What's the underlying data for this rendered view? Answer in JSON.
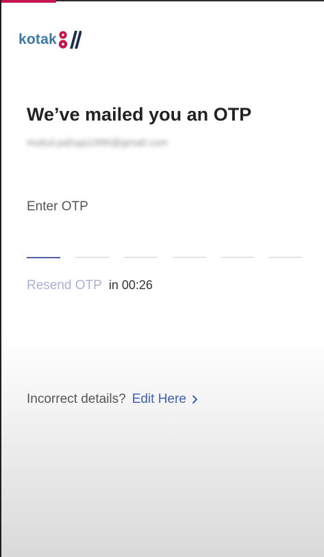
{
  "app": {
    "brand_name": "kotak",
    "brand_color": "#3a79a6",
    "accent_color": "#c4174d"
  },
  "header": {
    "title": "We’ve mailed you an OTP",
    "email": "mukul.pahuja1996@gmail.com"
  },
  "otp": {
    "label": "Enter OTP",
    "digit_count": 6,
    "active_digit_color": "#4f5fa4",
    "digits": [
      "",
      "",
      "",
      "",
      "",
      ""
    ]
  },
  "resend": {
    "label": "Resend OTP",
    "timer_prefix": "in",
    "timer_value": "00:26",
    "link_color": "#a9b1db"
  },
  "footer": {
    "question": "Incorrect details?",
    "edit_label": "Edit Here",
    "edit_icon": "chevron-right-icon",
    "link_color": "#3f5fb4"
  },
  "progress": {
    "fraction": 0.17
  }
}
